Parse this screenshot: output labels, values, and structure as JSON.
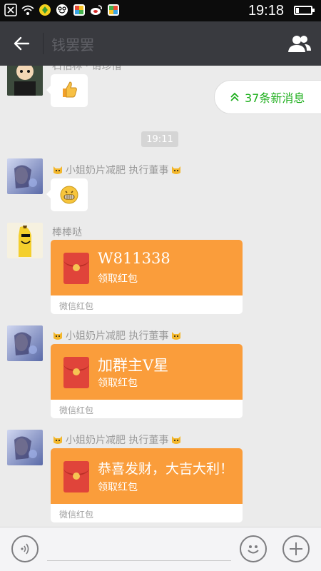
{
  "status_bar": {
    "time": "19:18",
    "battery_level": 0.18,
    "icons": [
      "notification-x-icon",
      "wifi-icon",
      "app-icon-green",
      "emoji-app-icon",
      "photo-app-icon",
      "weibo-icon",
      "photo-app-icon-2"
    ]
  },
  "header": {
    "title": "钱罢罢",
    "back_icon": "arrow-left-icon",
    "people_icon": "people-icon"
  },
  "messages": {
    "partial_sender": "石怕林 · 请珍惜",
    "time_label": "19:11",
    "new_messages": "37条新消息",
    "sender_group": "小姐奶片减肥 执行董事",
    "sender_banana": "棒棒哒",
    "packets": [
      {
        "title": "W811338",
        "subtitle": "领取红包",
        "footer": "微信红包"
      },
      {
        "title": "加群主V星",
        "subtitle": "领取红包",
        "footer": "微信红包"
      },
      {
        "title": "恭喜发财，大吉大利！",
        "subtitle": "领取红包",
        "footer": "微信红包"
      }
    ]
  },
  "bottom_bar": {
    "voice_icon": "voice-icon",
    "emoji_icon": "emoji-icon",
    "plus_icon": "plus-icon"
  },
  "colors": {
    "header_bg": "#393a3f",
    "chat_bg": "#ebebeb",
    "packet_orange": "#fa9d3b",
    "accent_green": "#1aad19"
  }
}
